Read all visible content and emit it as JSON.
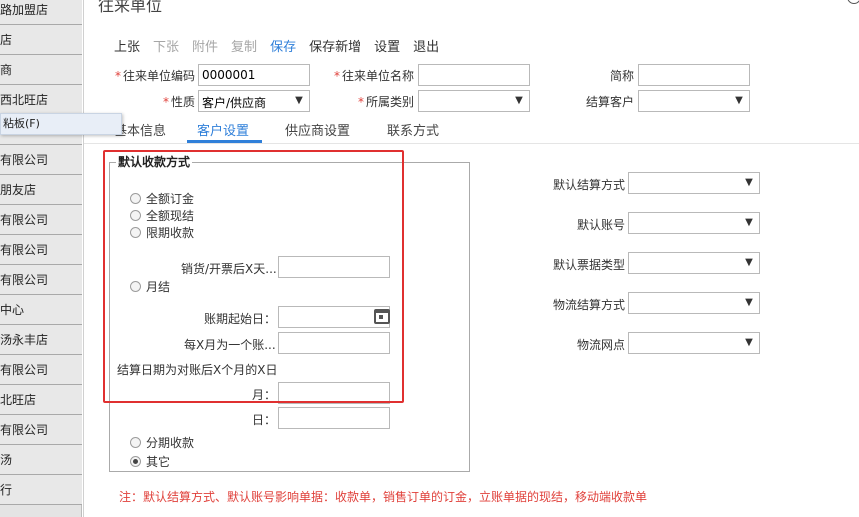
{
  "background_list": {
    "rows": [
      "路加盟店",
      "店",
      "商",
      "西北旺店",
      "",
      "有限公司",
      "朋友店",
      "有限公司",
      "有限公司",
      "有限公司",
      "中心",
      "汤永丰店",
      "有限公司",
      "北旺店",
      "有限公司",
      "汤",
      "行"
    ],
    "context_menu_item": "粘板(F)"
  },
  "dialog": {
    "title": "往来单位",
    "toolbar": {
      "prev": "上张",
      "next": "下张",
      "attachment": "附件",
      "copy": "复制",
      "save": "保存",
      "save_new": "保存新增",
      "settings": "设置",
      "exit": "退出"
    },
    "form": {
      "code_label": "往来单位编码",
      "code_value": "0000001",
      "name_label": "往来单位名称",
      "name_value": "",
      "short_label": "简称",
      "short_value": "",
      "nature_label": "性质",
      "nature_value": "客户/供应商",
      "category_label": "所属类别",
      "category_value": "",
      "settle_customer_label": "结算客户",
      "settle_customer_value": ""
    },
    "tabs": [
      "基本信息",
      "客户设置",
      "供应商设置",
      "联系方式"
    ],
    "active_tab": "客户设置",
    "payment": {
      "legend": "默认收款方式",
      "opt_full_deposit": "全额订金",
      "opt_full_cash": "全额现结",
      "opt_limited": "限期收款",
      "days_after_label": "销货/开票后X天...",
      "opt_monthly": "月结",
      "period_start_label": "账期起始日：",
      "every_x_months_label": "每X月为一个账...",
      "settle_date_label": "结算日期为对账后X个月的X日",
      "month_label": "月：",
      "day_label": "日：",
      "opt_installment": "分期收款",
      "opt_other": "其它",
      "selected": "其它"
    },
    "right_fields": {
      "settle_method_label": "默认结算方式",
      "account_label": "默认账号",
      "invoice_type_label": "默认票据类型",
      "logistics_settle_label": "物流结算方式",
      "logistics_point_label": "物流网点"
    },
    "note": "注：默认结算方式、默认账号影响单据：收款单，销售订单的订金，立账单据的现结，移动端收款单"
  },
  "colors": {
    "accent": "#2f7fd9",
    "required": "#e0413b",
    "highlight": "#e03030"
  }
}
